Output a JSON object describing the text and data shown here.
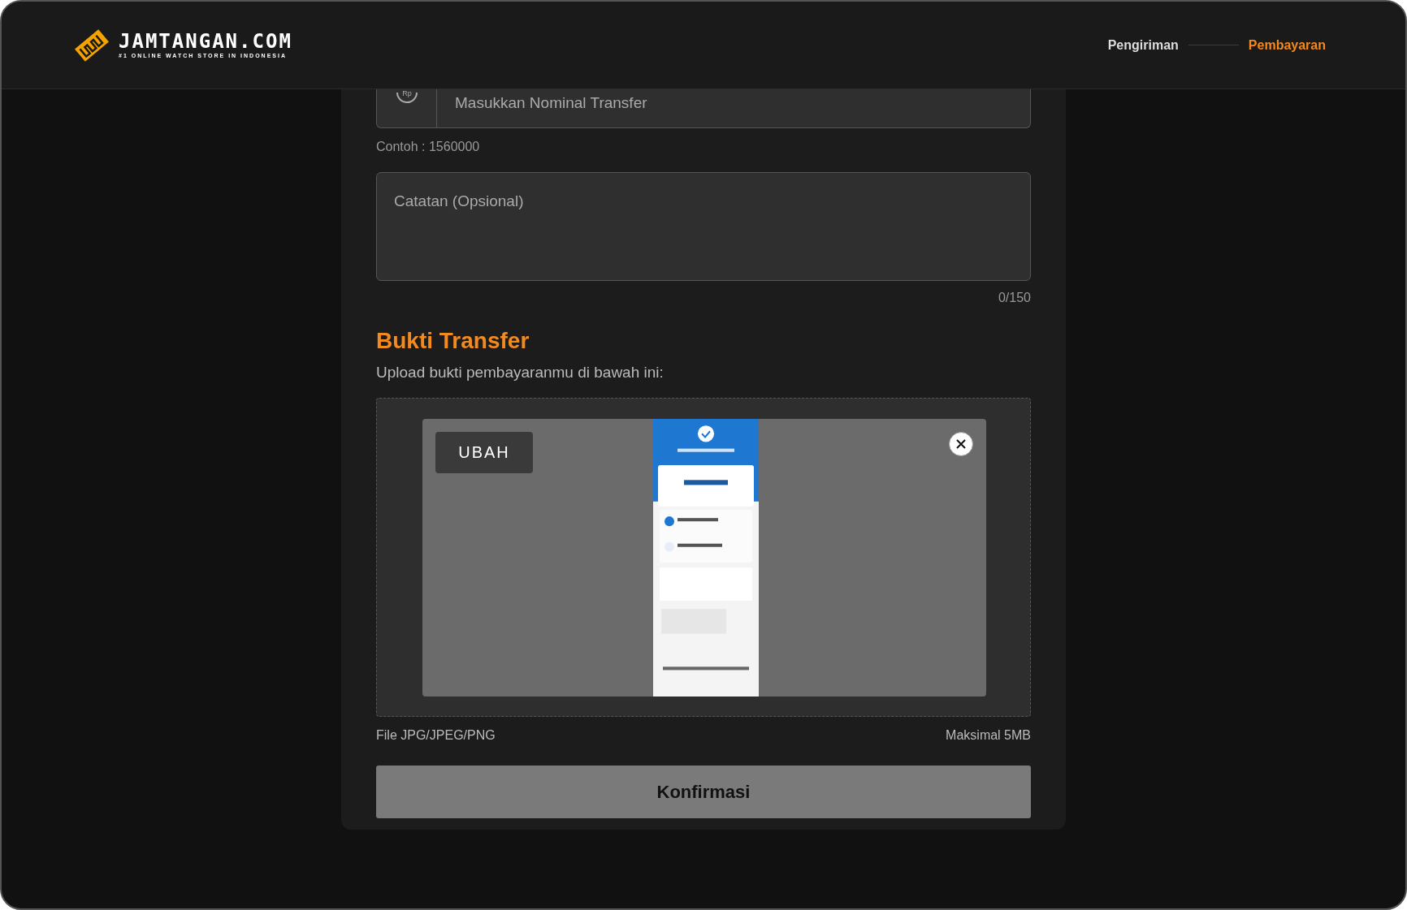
{
  "header": {
    "brand": "JAMTANGAN.COM",
    "tagline": "#1 ONLINE WATCH STORE IN INDONESIA",
    "steps": [
      {
        "label": "Pengiriman",
        "selected": false
      },
      {
        "label": "Pembayaran",
        "selected": true
      }
    ]
  },
  "amount": {
    "prefix": "Rp",
    "placeholder": "Masukkan Nominal Transfer",
    "hint": "Contoh : 1560000"
  },
  "note": {
    "placeholder": "Catatan (Opsional)",
    "counter": "0/150"
  },
  "upload": {
    "title": "Bukti Transfer",
    "subtitle": "Upload bukti pembayaranmu di bawah ini:",
    "change_button": "UBAH",
    "file_types": "File JPG/JPEG/PNG",
    "max_size": "Maksimal 5MB"
  },
  "confirm_button": "Konfirmasi"
}
